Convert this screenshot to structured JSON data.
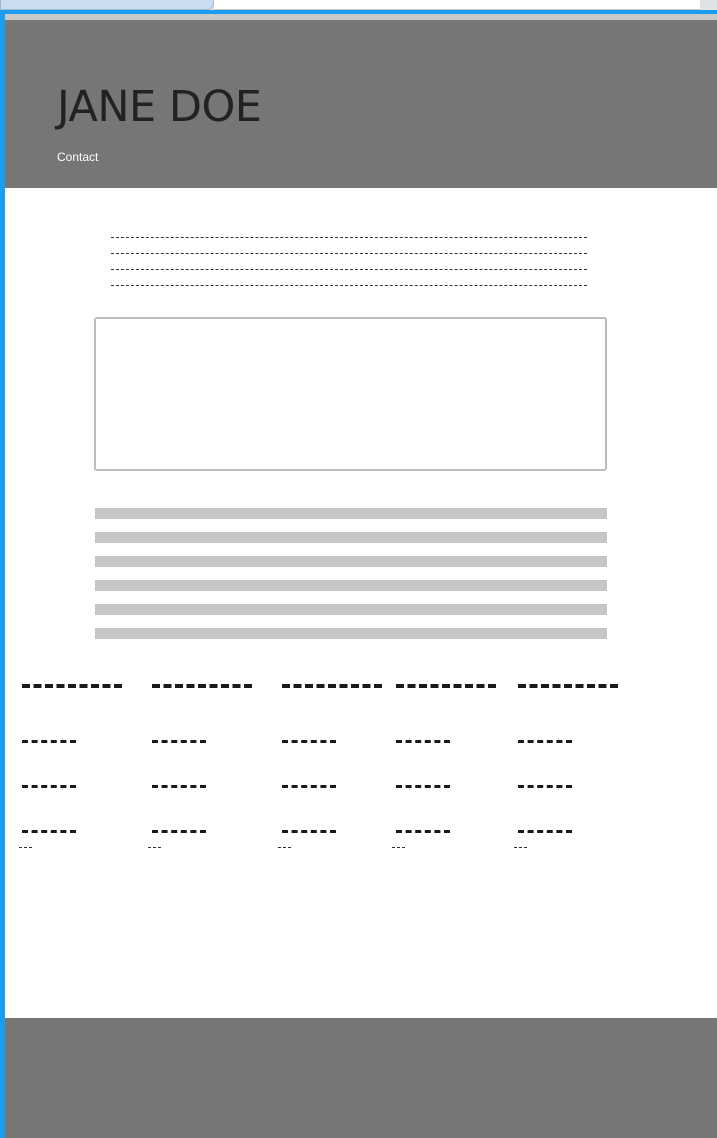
{
  "header": {
    "title": "JANE DOE",
    "nav_contact": "Contact"
  },
  "intro": {
    "lines": [
      "------------------------------------------------------------------------------------------",
      "------------------------------------------------------------------------------------------",
      "------------------------------------------------------------------------------------------",
      "------------------------------------------------------------------------------------------"
    ]
  },
  "table": {
    "headers": [
      "-----",
      "-----",
      "-----",
      "-----",
      "-----"
    ],
    "rows": [
      [
        "----",
        "----",
        "----",
        "----",
        "----"
      ],
      [
        "----",
        "----",
        "----",
        "----",
        "----"
      ],
      [
        "----",
        "----",
        "----",
        "----",
        "----"
      ]
    ],
    "notes": [
      "----",
      "----",
      "----",
      "----",
      "----"
    ]
  },
  "colors": {
    "header_bg": "#767676",
    "frame_accent": "#1a9cf0",
    "bar_gray": "#c6c6c6"
  }
}
